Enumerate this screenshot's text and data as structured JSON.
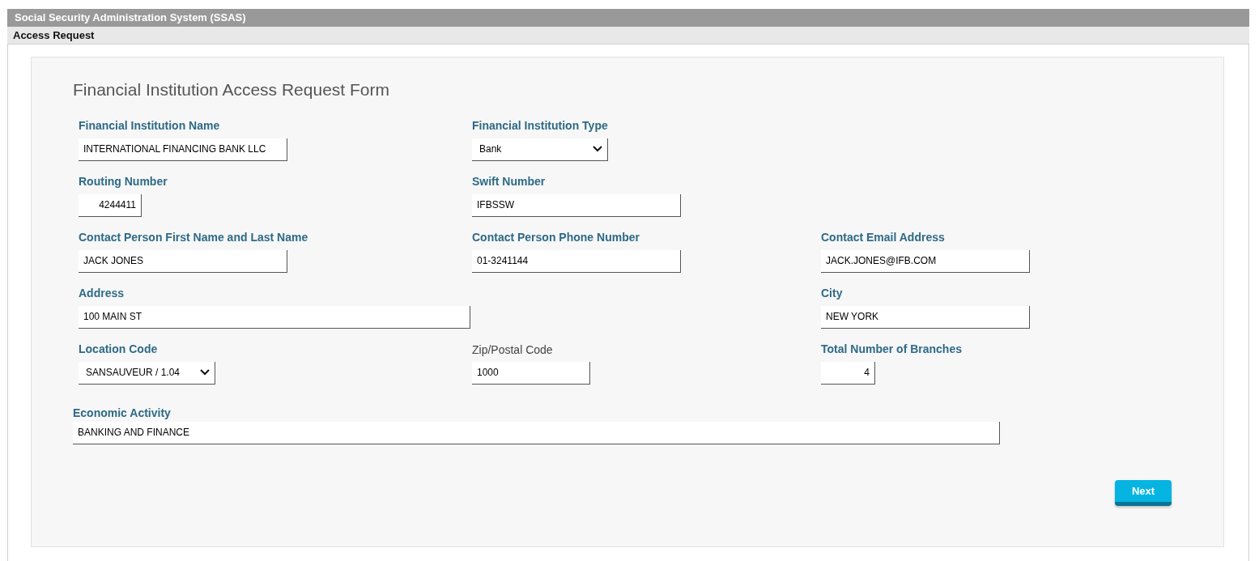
{
  "window": {
    "title": "Social Security Administration System (SSAS)"
  },
  "breadcrumb": "Access Request",
  "form": {
    "title": "Financial Institution Access Request Form",
    "fields": [
      {
        "label": "Financial Institution Name",
        "required": true,
        "kind": "text",
        "value": "INTERNATIONAL FINANCING BANK LLC"
      },
      {
        "label": "Financial Institution Type",
        "required": true,
        "kind": "select",
        "value": "Bank"
      },
      {
        "label": "Routing Number",
        "required": true,
        "kind": "number",
        "value": "4244411"
      },
      {
        "label": "Swift Number",
        "required": true,
        "kind": "text",
        "value": "IFBSSW"
      },
      {
        "label": "Contact Person First Name and Last Name",
        "required": true,
        "kind": "text",
        "value": "JACK JONES"
      },
      {
        "label": "Contact Person Phone Number",
        "required": true,
        "kind": "text",
        "value": "01-3241144"
      },
      {
        "label": "Contact Email Address",
        "required": true,
        "kind": "text",
        "value": "JACK.JONES@IFB.COM"
      },
      {
        "label": "Address",
        "required": true,
        "kind": "text",
        "value": "100 MAIN ST"
      },
      {
        "label": "City",
        "required": true,
        "kind": "text",
        "value": "NEW YORK"
      },
      {
        "label": "Location Code",
        "required": true,
        "kind": "select",
        "value": "SANSAUVEUR / 1.04"
      },
      {
        "label": "Zip/Postal Code",
        "required": false,
        "kind": "text",
        "value": "1000"
      },
      {
        "label": "Total Number of Branches",
        "required": true,
        "kind": "number",
        "value": "4"
      }
    ],
    "economic_activity": {
      "label": "Economic Activity",
      "required": true,
      "value": "BANKING AND FINANCE"
    },
    "buttons": [
      "Next"
    ]
  }
}
